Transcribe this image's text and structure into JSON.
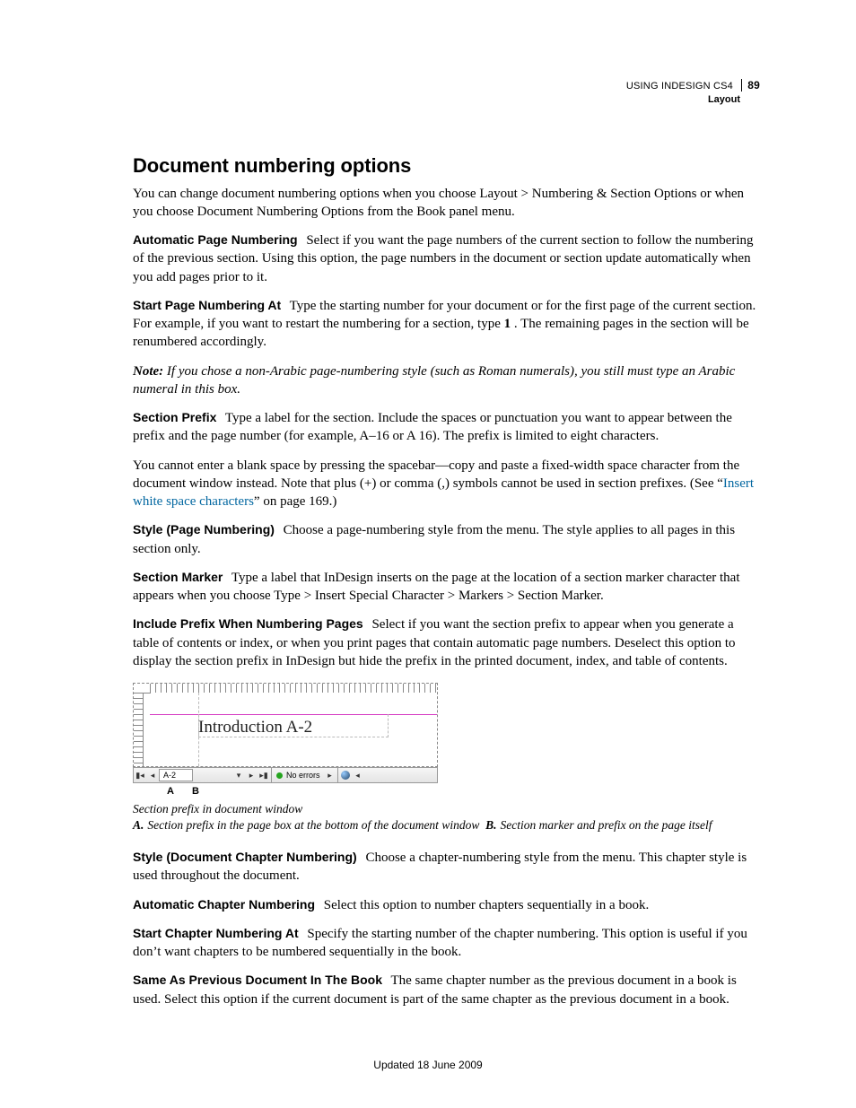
{
  "header": {
    "source": "USING INDESIGN CS4",
    "section": "Layout",
    "page_number": "89"
  },
  "title": "Document numbering options",
  "intro": "You can change document numbering options when you choose Layout > Numbering & Section Options or when you choose Document Numbering Options from the Book panel menu.",
  "items": {
    "auto_page_numbering": {
      "term": "Automatic Page Numbering",
      "body": "Select if you want the page numbers of the current section to follow the numbering of the previous section. Using this option, the page numbers in the document or section update automatically when you add pages prior to it."
    },
    "start_page_numbering_at": {
      "term": "Start Page Numbering At",
      "body_a": "Type the starting number for your document or for the first page of the current section. For example, if you want to restart the numbering for a section, type ",
      "value": "1",
      "body_b": " . The remaining pages in the section will be renumbered accordingly."
    },
    "note": {
      "label": "Note:",
      "body": "If you chose a non-Arabic page-numbering style (such as Roman numerals), you still must type an Arabic numeral in this box."
    },
    "section_prefix": {
      "term": "Section Prefix",
      "body": "Type a label for the section. Include the spaces or punctuation you want to appear between the prefix and the page number (for example, A–16 or A 16). The prefix is limited to eight characters."
    },
    "section_prefix_extra": {
      "a": "You cannot enter a blank space by pressing the spacebar—copy and paste a fixed-width space character from the document window instead. Note that plus (+) or comma (,) symbols cannot be used in section prefixes. (See “",
      "link": "Insert white space characters",
      "b": "” on page 169.)"
    },
    "style_page_numbering": {
      "term": "Style (Page Numbering)",
      "body": "Choose a page-numbering style from the menu. The style applies to all pages in this section only."
    },
    "section_marker": {
      "term": "Section Marker",
      "body": "Type a label that InDesign inserts on the page at the location of a section marker character that appears when you choose Type > Insert Special Character > Markers > Section Marker."
    },
    "include_prefix": {
      "term": "Include Prefix When Numbering Pages",
      "body": "Select if you want the section prefix to appear when you generate a table of contents or index, or when you print pages that contain automatic page numbers. Deselect this option to display the section prefix in InDesign but hide the prefix in the printed document, index, and table of contents."
    },
    "style_doc_chapter": {
      "term": "Style (Document Chapter Numbering)",
      "body": "Choose a chapter-numbering style from the menu. This chapter style is used throughout the document."
    },
    "auto_chapter_numbering": {
      "term": "Automatic Chapter Numbering",
      "body": "Select this option to number chapters sequentially in a book."
    },
    "start_chapter_numbering_at": {
      "term": "Start Chapter Numbering At",
      "body": "Specify the starting number of the chapter numbering. This option is useful if you don’t want chapters to be numbered sequentially in the book."
    },
    "same_as_previous": {
      "term": "Same As Previous Document In The Book",
      "body": "The same chapter number as the previous document in a book is used. Select this option if the current document is part of the same chapter as the previous document in a book."
    }
  },
  "figure": {
    "page_text": "Introduction A-2",
    "status_page": "A-2",
    "status_errors": "No errors",
    "label_A": "A",
    "label_B": "B"
  },
  "caption": {
    "title": "Section prefix in document window",
    "a_key": "A.",
    "a_text": "Section prefix in the page box at the bottom of the document window",
    "b_key": "B.",
    "b_text": "Section marker and prefix on the page itself"
  },
  "footer": "Updated 18 June 2009"
}
